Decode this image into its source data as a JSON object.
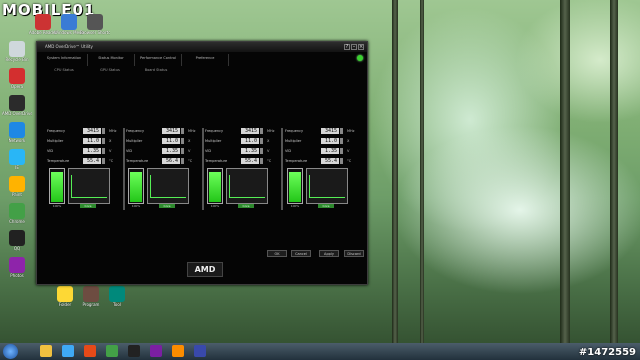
{
  "watermark": {
    "logo": "MOBILE01",
    "id": "#1472559"
  },
  "desktop": {
    "icons": [
      {
        "label": "Adobe Reader",
        "color": "#c33"
      },
      {
        "label": "Windows Messenger",
        "color": "#3a7bd5"
      },
      {
        "label": "Browser Shortcut",
        "color": "#555"
      },
      {
        "label": "Recycle Bin",
        "color": "#cfd8dc"
      },
      {
        "label": "Opera",
        "color": "#d32f2f"
      },
      {
        "label": "AMD OverDrive",
        "color": "#2b2b2b"
      },
      {
        "label": "Network",
        "color": "#1e88e5"
      },
      {
        "label": "IE",
        "color": "#29b6f6"
      },
      {
        "label": "Paint",
        "color": "#ffb300"
      },
      {
        "label": "Chrome",
        "color": "#43a047"
      },
      {
        "label": "QQ",
        "color": "#212121"
      },
      {
        "label": "Photos",
        "color": "#8e24aa"
      },
      {
        "label": "Folder",
        "color": "#fdd835"
      },
      {
        "label": "Program",
        "color": "#6d4c41"
      },
      {
        "label": "Tool",
        "color": "#00897b"
      }
    ]
  },
  "window": {
    "title": "AMD OverDrive™ Utility",
    "tabs": [
      "System Information",
      "Status Monitor",
      "Performance Control",
      "Preference"
    ],
    "subtabs": [
      "CPU Status",
      "GPU Status",
      "Board Status"
    ],
    "row_labels": [
      "Frequency",
      "Multiplier",
      "VID",
      "Temperature"
    ],
    "units": [
      "MHz",
      "X",
      "V",
      "°C"
    ],
    "gpus": [
      {
        "values": [
          "3415",
          "11.0",
          "1.35",
          "55.4"
        ],
        "meter_label": "100%",
        "graph_label": "Core",
        "load": 0.95
      },
      {
        "values": [
          "3415",
          "11.0",
          "1.35",
          "56.4"
        ],
        "meter_label": "100%",
        "graph_label": "Core",
        "load": 0.95
      },
      {
        "values": [
          "3415",
          "11.0",
          "1.35",
          "55.4"
        ],
        "meter_label": "100%",
        "graph_label": "Core",
        "load": 0.95
      },
      {
        "values": [
          "3415",
          "11.0",
          "1.35",
          "55.4"
        ],
        "meter_label": "100%",
        "graph_label": "Core",
        "load": 0.95
      }
    ],
    "buttons": [
      "OK",
      "Cancel",
      "Apply",
      "Discard"
    ],
    "brand": "AMD"
  },
  "taskbar": {
    "items": [
      {
        "name": "explorer",
        "color": "#f0c040"
      },
      {
        "name": "ie",
        "color": "#3fa9f5"
      },
      {
        "name": "media",
        "color": "#e64a19"
      },
      {
        "name": "chrome",
        "color": "#43a047"
      },
      {
        "name": "qq",
        "color": "#222"
      },
      {
        "name": "app",
        "color": "#7b1fa2"
      },
      {
        "name": "app2",
        "color": "#fb8c00"
      },
      {
        "name": "app3",
        "color": "#3949ab"
      }
    ]
  }
}
